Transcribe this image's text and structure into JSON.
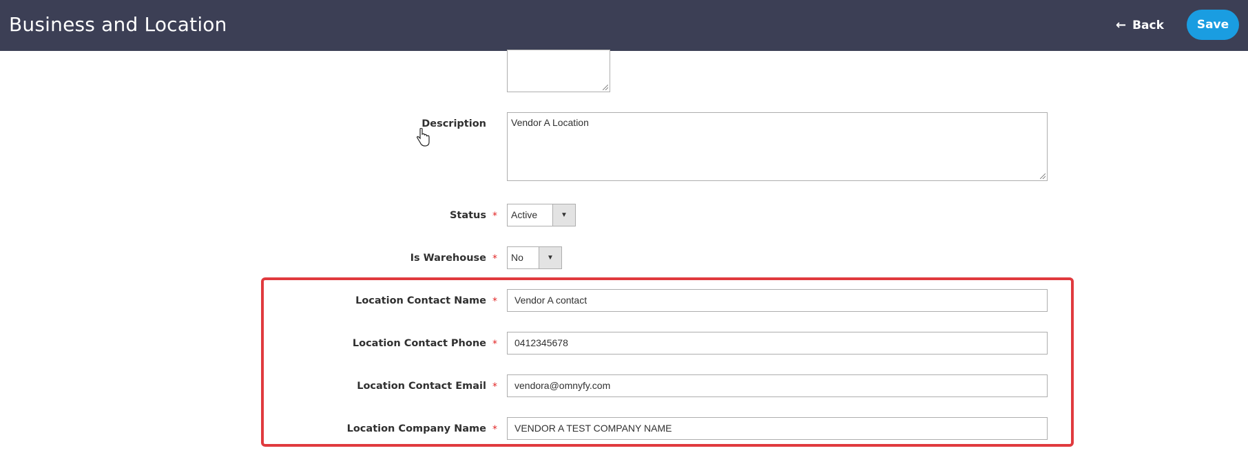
{
  "header": {
    "title": "Business and Location",
    "back_label": "Back",
    "save_label": "Save"
  },
  "form": {
    "description": {
      "label": "Description",
      "value": "Vendor A Location"
    },
    "status": {
      "label": "Status",
      "value": "Active",
      "required_mark": "*"
    },
    "is_warehouse": {
      "label": "Is Warehouse",
      "value": "No",
      "required_mark": "*"
    },
    "contact_name": {
      "label": "Location Contact Name",
      "value": "Vendor A contact",
      "required_mark": "*"
    },
    "contact_phone": {
      "label": "Location Contact Phone",
      "value": "0412345678",
      "required_mark": "*"
    },
    "contact_email": {
      "label": "Location Contact Email",
      "value": "vendora@omnyfy.com",
      "required_mark": "*"
    },
    "company_name": {
      "label": "Location Company Name",
      "value": "VENDOR A TEST COMPANY NAME",
      "required_mark": "*"
    }
  },
  "colors": {
    "header_bg": "#3c3f55",
    "save_bg": "#1a9de1",
    "highlight": "#e03a3e",
    "required": "#e22626"
  },
  "icons": {
    "back": "arrow-left-icon",
    "dropdown": "triangle-down-icon",
    "cursor": "hand-pointer-icon"
  }
}
